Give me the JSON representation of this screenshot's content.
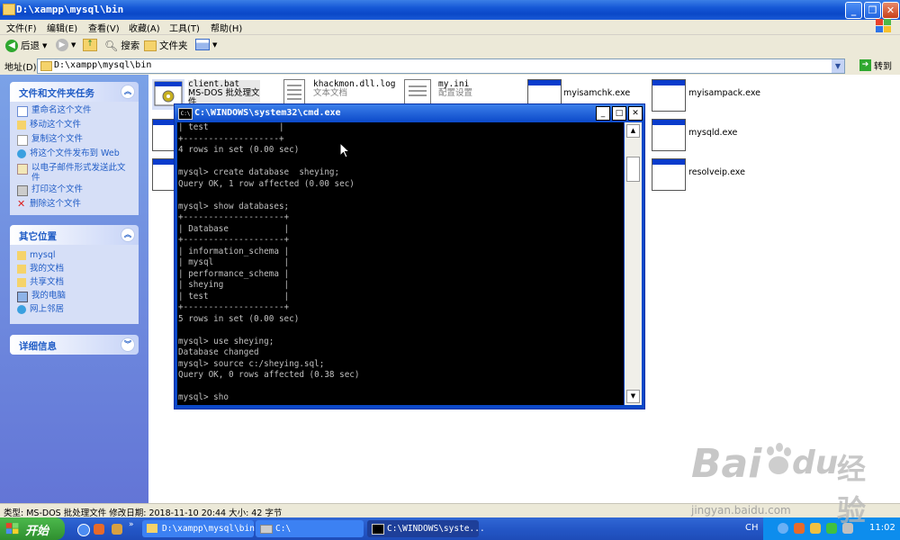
{
  "window": {
    "title": "D:\\xampp\\mysql\\bin"
  },
  "menu": [
    "文件(F)",
    "编辑(E)",
    "查看(V)",
    "收藏(A)",
    "工具(T)",
    "帮助(H)"
  ],
  "toolbar": {
    "back": "后退",
    "search": "搜索",
    "folders": "文件夹"
  },
  "address": {
    "label": "地址(D)",
    "path": "D:\\xampp\\mysql\\bin",
    "go": "转到"
  },
  "left_pane": {
    "tasks_title": "文件和文件夹任务",
    "tasks": [
      "重命名这个文件",
      "移动这个文件",
      "复制这个文件",
      "将这个文件发布到 Web",
      "以电子邮件形式发送此文件",
      "打印这个文件",
      "删除这个文件"
    ],
    "places_title": "其它位置",
    "places": [
      "mysql",
      "我的文档",
      "共享文档",
      "我的电脑",
      "网上邻居"
    ],
    "details_title": "详细信息"
  },
  "files": {
    "client": {
      "name": "client.bat",
      "type": "MS-DOS 批处理文件"
    },
    "khack": {
      "name": "khackmon.dll.log",
      "type": "文本文档"
    },
    "myini": {
      "name": "my.ini",
      "type": "配置设置"
    },
    "myisamchk": {
      "name": "myisamchk.exe"
    },
    "myisampack": {
      "name": "myisampack.exe"
    },
    "mysqld": {
      "name": "mysqld.exe"
    },
    "resolveip": {
      "name": "resolveip.exe"
    }
  },
  "cmd": {
    "title": "C:\\WINDOWS\\system32\\cmd.exe",
    "lines": [
      "| test              |",
      "+-------------------+",
      "4 rows in set (0.00 sec)",
      "",
      "mysql> create database  sheying;",
      "Query OK, 1 row affected (0.00 sec)",
      "",
      "mysql> show databases;",
      "+--------------------+",
      "| Database           |",
      "+--------------------+",
      "| information_schema |",
      "| mysql              |",
      "| performance_schema |",
      "| sheying            |",
      "| test               |",
      "+--------------------+",
      "5 rows in set (0.00 sec)",
      "",
      "mysql> use sheying;",
      "Database changed",
      "mysql> source c:/sheying.sql;",
      "Query OK, 0 rows affected (0.38 sec)",
      "",
      "mysql> sho"
    ]
  },
  "status": {
    "text": "类型: MS-DOS 批处理文件 修改日期: 2018-11-10 20:44 大小: 42 字节"
  },
  "taskbar": {
    "start": "开始",
    "items": [
      "D:\\xampp\\mysql\\bin",
      "C:\\",
      "C:\\WINDOWS\\syste..."
    ],
    "lang": "CH",
    "time": "11:02"
  },
  "watermark": {
    "brand": "Bai",
    "brand2": "du",
    "cn": "经验",
    "url": "jingyan.baidu.com"
  }
}
